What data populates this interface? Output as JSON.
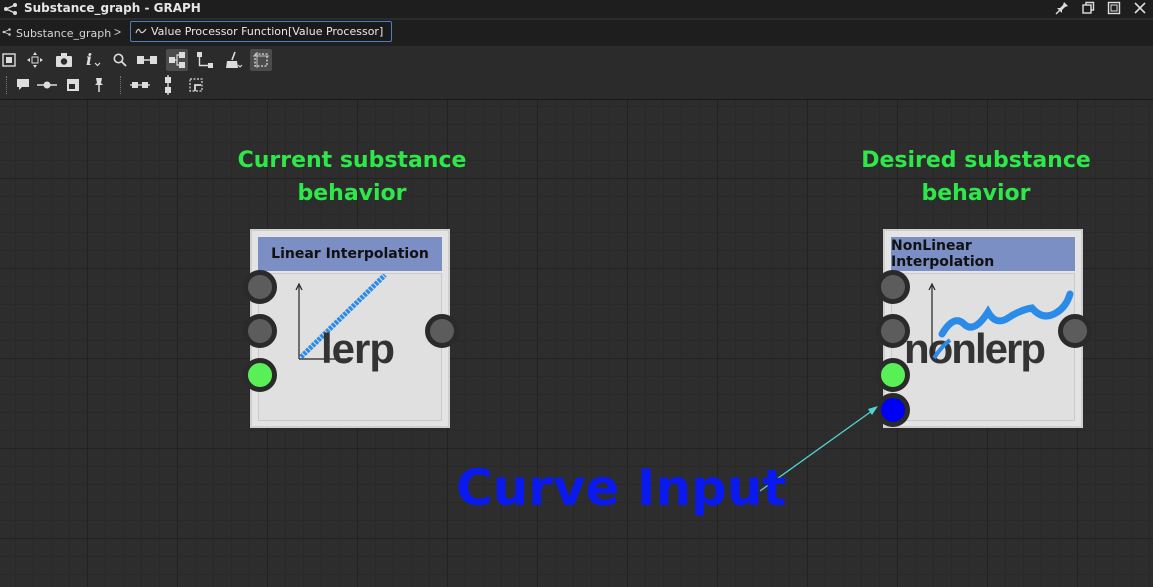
{
  "window": {
    "title": "Substance_graph - GRAPH",
    "icons": [
      "graph-icon",
      "pin-icon",
      "restore-icon",
      "maximize-icon",
      "close-icon"
    ]
  },
  "breadcrumb": {
    "root": "Substance_graph",
    "separator": ">",
    "current": "Value Processor Function[Value Processor]"
  },
  "toolbar": {
    "row1": [
      "fit-view-icon",
      "move-icon",
      "camera-icon",
      "info-icon",
      "search-icon",
      "node-link-icon",
      "hierarchy-icon",
      "connector-icon",
      "cleanup-icon",
      "frame-select-icon"
    ],
    "row2": [
      "comment-icon",
      "dot-icon",
      "frame-icon",
      "pin-node-icon",
      "align-horizontal-icon",
      "align-vertical-icon",
      "snap-icon"
    ]
  },
  "graph": {
    "left_heading": [
      "Current substance",
      "behavior"
    ],
    "right_heading": [
      "Desired substance",
      "behavior"
    ],
    "left_node": {
      "title": "Linear Interpolation",
      "thumbnail_text": "lerp"
    },
    "right_node": {
      "title": "NonLinear Interpolation",
      "thumbnail_text": "nonlerp"
    },
    "callout": "Curve Input"
  },
  "colors": {
    "heading_green": "#2ee84a",
    "callout_blue": "#0a1aef",
    "curve_blue": "#2a8be8",
    "node_header": "#7b8fc4",
    "port_green": "#59ef57",
    "port_blue": "#0000f5",
    "arrow_cyan": "#4fd4d4"
  }
}
